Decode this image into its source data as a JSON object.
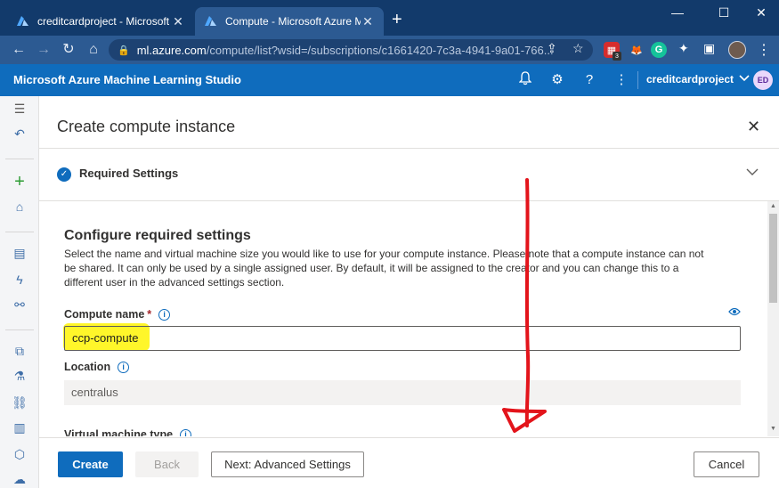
{
  "browser": {
    "tabs": [
      {
        "title": "creditcardproject - Microsoft Azu",
        "active": false
      },
      {
        "title": "Compute - Microsoft Azure Mach",
        "active": true
      }
    ],
    "new_tab": "+",
    "address": {
      "host": "ml.azure.com",
      "path": "/compute/list?wsid=/subscriptions/c1661420-7c3a-4941-9a01-766..."
    },
    "extension_badge": "3",
    "extension_letter": "G"
  },
  "header": {
    "app_title": "Microsoft Azure Machine Learning Studio",
    "workspace": "creditcardproject",
    "user_initials": "ED",
    "accent": "#0f6cbd"
  },
  "panel": {
    "title": "Create compute instance",
    "step": "Required Settings",
    "section_title": "Configure required settings",
    "section_desc": "Select the name and virtual machine size you would like to use for your compute instance. Please note that a compute instance can not be shared. It can only be used by a single assigned user. By default, it will be assigned to the creator and you can change this to a different user in the advanced settings section.",
    "compute_name_label": "Compute name",
    "required_marker": "*",
    "compute_name_value": "ccp-compute",
    "location_label": "Location",
    "location_value": "centralus",
    "vm_type_label": "Virtual machine type"
  },
  "footer": {
    "create": "Create",
    "back": "Back",
    "next": "Next: Advanced Settings",
    "cancel": "Cancel"
  },
  "annotation": {
    "highlight_color": "#fff61f",
    "arrow_color": "#e3141b"
  }
}
